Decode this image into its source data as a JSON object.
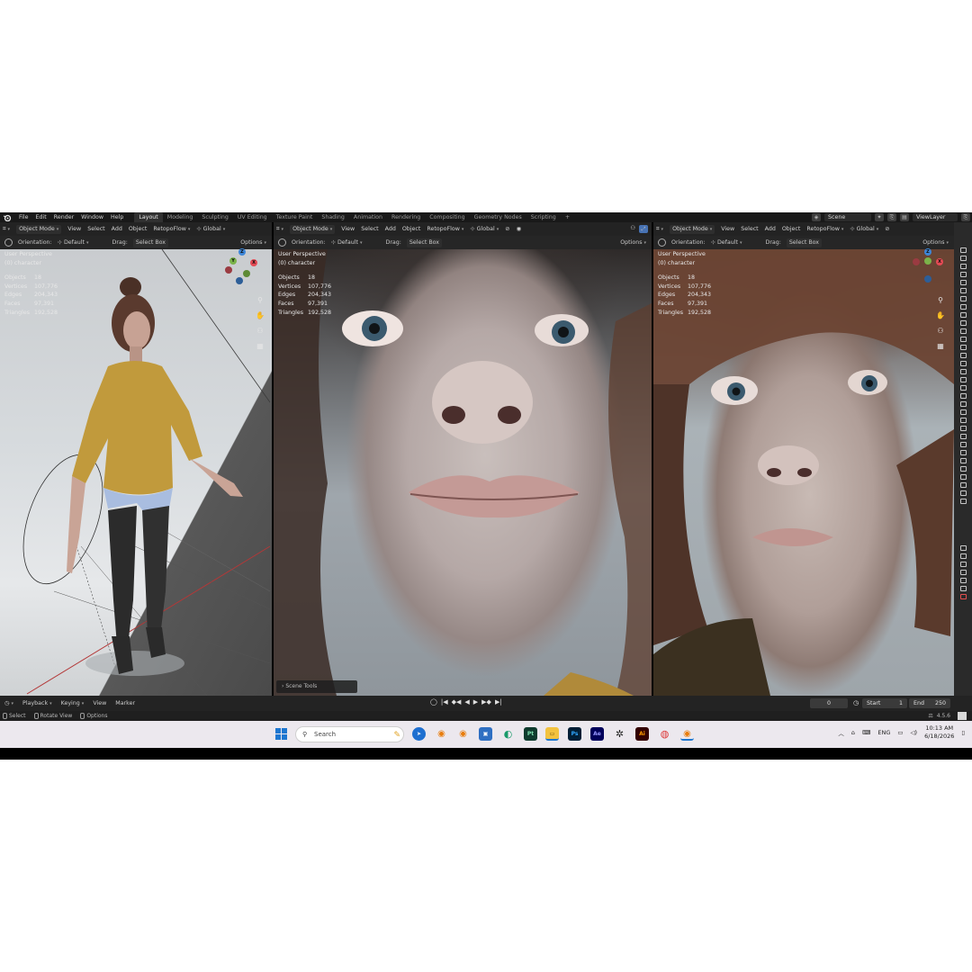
{
  "topbar": {
    "menus": [
      "File",
      "Edit",
      "Render",
      "Window",
      "Help"
    ],
    "workspaces": [
      "Layout",
      "Modeling",
      "Sculpting",
      "UV Editing",
      "Texture Paint",
      "Shading",
      "Animation",
      "Rendering",
      "Compositing",
      "Geometry Nodes",
      "Scripting"
    ],
    "active_workspace": "Layout",
    "add_tab": "+",
    "scene": "Scene",
    "view_layer": "ViewLayer"
  },
  "viewport_header": {
    "mode": "Object Mode",
    "menus": [
      "View",
      "Select",
      "Add",
      "Object"
    ],
    "addon": "RetopoFlow",
    "transform": "Global",
    "orientation_label": "Orientation:",
    "orientation_value": "Default",
    "drag_label": "Drag:",
    "drag_value": "Select Box",
    "options": "Options"
  },
  "overlay": {
    "view_name": "User Perspective",
    "collection": "(0) character",
    "stats": [
      {
        "label": "Objects",
        "value": "18"
      },
      {
        "label": "Vertices",
        "value": "107,776"
      },
      {
        "label": "Edges",
        "value": "204,343"
      },
      {
        "label": "Faces",
        "value": "97,391"
      },
      {
        "label": "Triangles",
        "value": "192,528"
      }
    ]
  },
  "scene_tools": "Scene Tools",
  "timeline": {
    "menus": [
      "Playback",
      "Keying",
      "View",
      "Marker"
    ],
    "current_frame": "0",
    "start_label": "Start",
    "start_value": "1",
    "end_label": "End",
    "end_value": "250"
  },
  "statusbar": {
    "items": [
      "Select",
      "Rotate View",
      "Options"
    ],
    "version": "4.5.6"
  },
  "taskbar": {
    "search_placeholder": "Search",
    "language": "ENG",
    "time": "10:13 AM",
    "date": "6/18/2026",
    "apps": [
      "Pt",
      "Ps",
      "Ae",
      "Ai"
    ]
  },
  "colors": {
    "axis_x": "#e44a54",
    "axis_y": "#7bb34a",
    "axis_z": "#3d86d8"
  }
}
